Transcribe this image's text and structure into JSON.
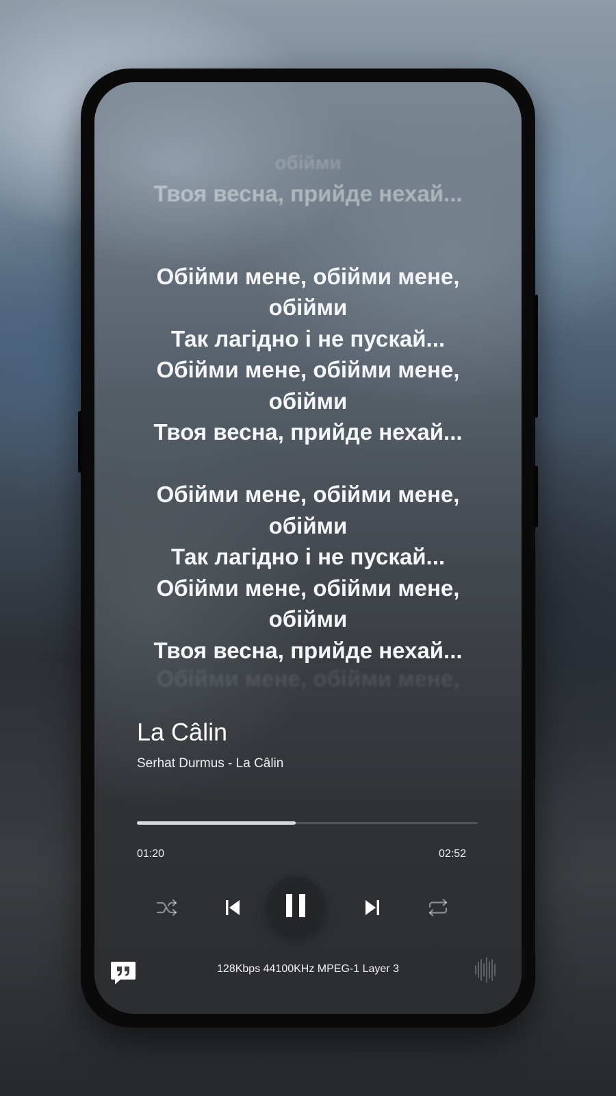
{
  "lyrics": {
    "faded_top": [
      "обійми",
      "Твоя весна, прийде нехай..."
    ],
    "lines": [
      "",
      "Обійми мене, обійми мене,",
      "обійми",
      "Так лагідно і не пускай...",
      "Обійми мене, обійми мене,",
      "обійми",
      "Твоя весна, прийде нехай...",
      "",
      "Обійми мене, обійми мене,",
      "обійми",
      "Так лагідно і не пускай...",
      "Обійми мене, обійми мене,",
      "обійми",
      "Твоя весна, прийде нехай..."
    ],
    "faded_bottom": "Обійми мене, обійми мене,"
  },
  "track": {
    "title": "La Câlin",
    "subtitle": "Serhat Durmus - La Câlin"
  },
  "playback": {
    "elapsed": "01:20",
    "duration": "02:52",
    "progress_fraction": 0.465
  },
  "controls": {
    "shuffle_icon": "shuffle-icon",
    "previous_icon": "skip-previous-icon",
    "pause_icon": "pause-icon",
    "next_icon": "skip-next-icon",
    "repeat_icon": "repeat-icon"
  },
  "footer": {
    "format_info": "128Kbps 44100KHz MPEG-1 Layer 3",
    "lyrics_icon": "quote-icon",
    "visualizer_icon": "waveform-icon"
  }
}
